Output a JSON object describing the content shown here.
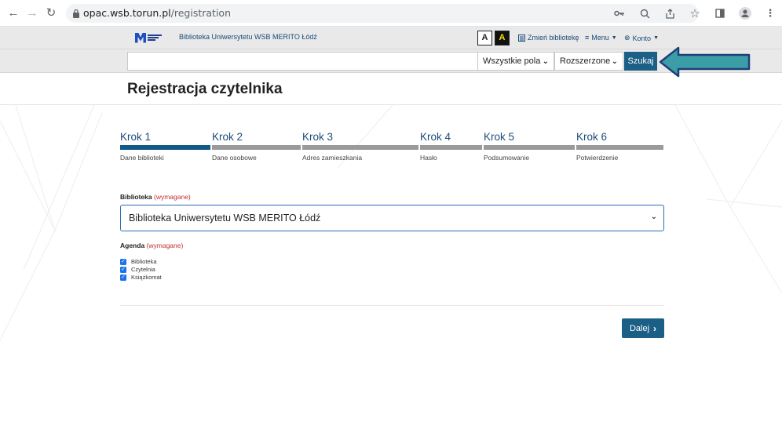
{
  "browser": {
    "url_host": "opac.wsb.torun.pl",
    "url_path": "/registration"
  },
  "header": {
    "library_name": "Biblioteka Uniwersytetu WSB MERITO Łódź",
    "contrast_normal": "A",
    "contrast_high": "A",
    "change_library": "Zmień bibliotekę",
    "menu": "Menu",
    "account": "Konto"
  },
  "search": {
    "input_value": "",
    "field_select": "Wszystkie pola",
    "mode_select": "Rozszerzone",
    "button": "Szukaj"
  },
  "page": {
    "title": "Rejestracja czytelnika"
  },
  "steps": [
    {
      "title": "Krok 1",
      "subtitle": "Dane biblioteki",
      "active": true
    },
    {
      "title": "Krok 2",
      "subtitle": "Dane osobowe",
      "active": false
    },
    {
      "title": "Krok 3",
      "subtitle": "Adres zamieszkania",
      "active": false
    },
    {
      "title": "Krok 4",
      "subtitle": "Hasło",
      "active": false
    },
    {
      "title": "Krok 5",
      "subtitle": "Podsumowanie",
      "active": false
    },
    {
      "title": "Krok 6",
      "subtitle": "Potwierdzenie",
      "active": false
    }
  ],
  "form": {
    "library_label": "Biblioteka",
    "required_text": "(wymagane)",
    "library_value": "Biblioteka Uniwersytetu WSB MERITO Łódź",
    "agenda_label": "Agenda",
    "agenda_items": [
      {
        "label": "Biblioteka",
        "checked": true
      },
      {
        "label": "Czytelnia",
        "checked": true
      },
      {
        "label": "Książkomat",
        "checked": true
      }
    ],
    "next_button": "Dalej"
  },
  "colors": {
    "accent": "#1b5e86",
    "link": "#1c4a7a",
    "required": "#c0302d",
    "arrow_fill": "#3b9ea6",
    "arrow_stroke": "#1f3f7a"
  }
}
